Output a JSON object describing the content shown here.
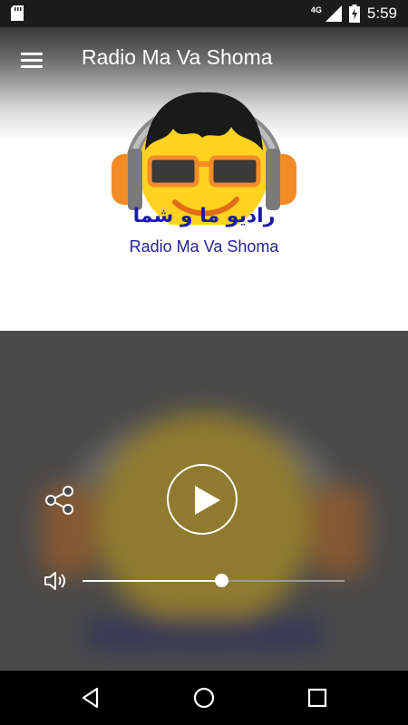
{
  "status_bar": {
    "network": "4G",
    "time": "5:59",
    "icons": [
      "sd-card-icon",
      "signal-icon",
      "battery-charging-icon"
    ]
  },
  "toolbar": {
    "title": "Radio Ma Va Shoma",
    "menu_icon": "hamburger-menu-icon"
  },
  "logo": {
    "arabic_text": "رادیو ما و شما",
    "latin_text": "Radio Ma Va Shoma",
    "colors": {
      "face": "#FFD21F",
      "headphone": "#F28C28",
      "text": "#1a1aa8"
    }
  },
  "player": {
    "share_icon": "share-icon",
    "play_icon": "play-icon",
    "volume_icon": "volume-icon",
    "volume_level": 0.53
  },
  "nav_bar": {
    "icons": [
      "back-icon",
      "home-icon",
      "recents-icon"
    ]
  }
}
